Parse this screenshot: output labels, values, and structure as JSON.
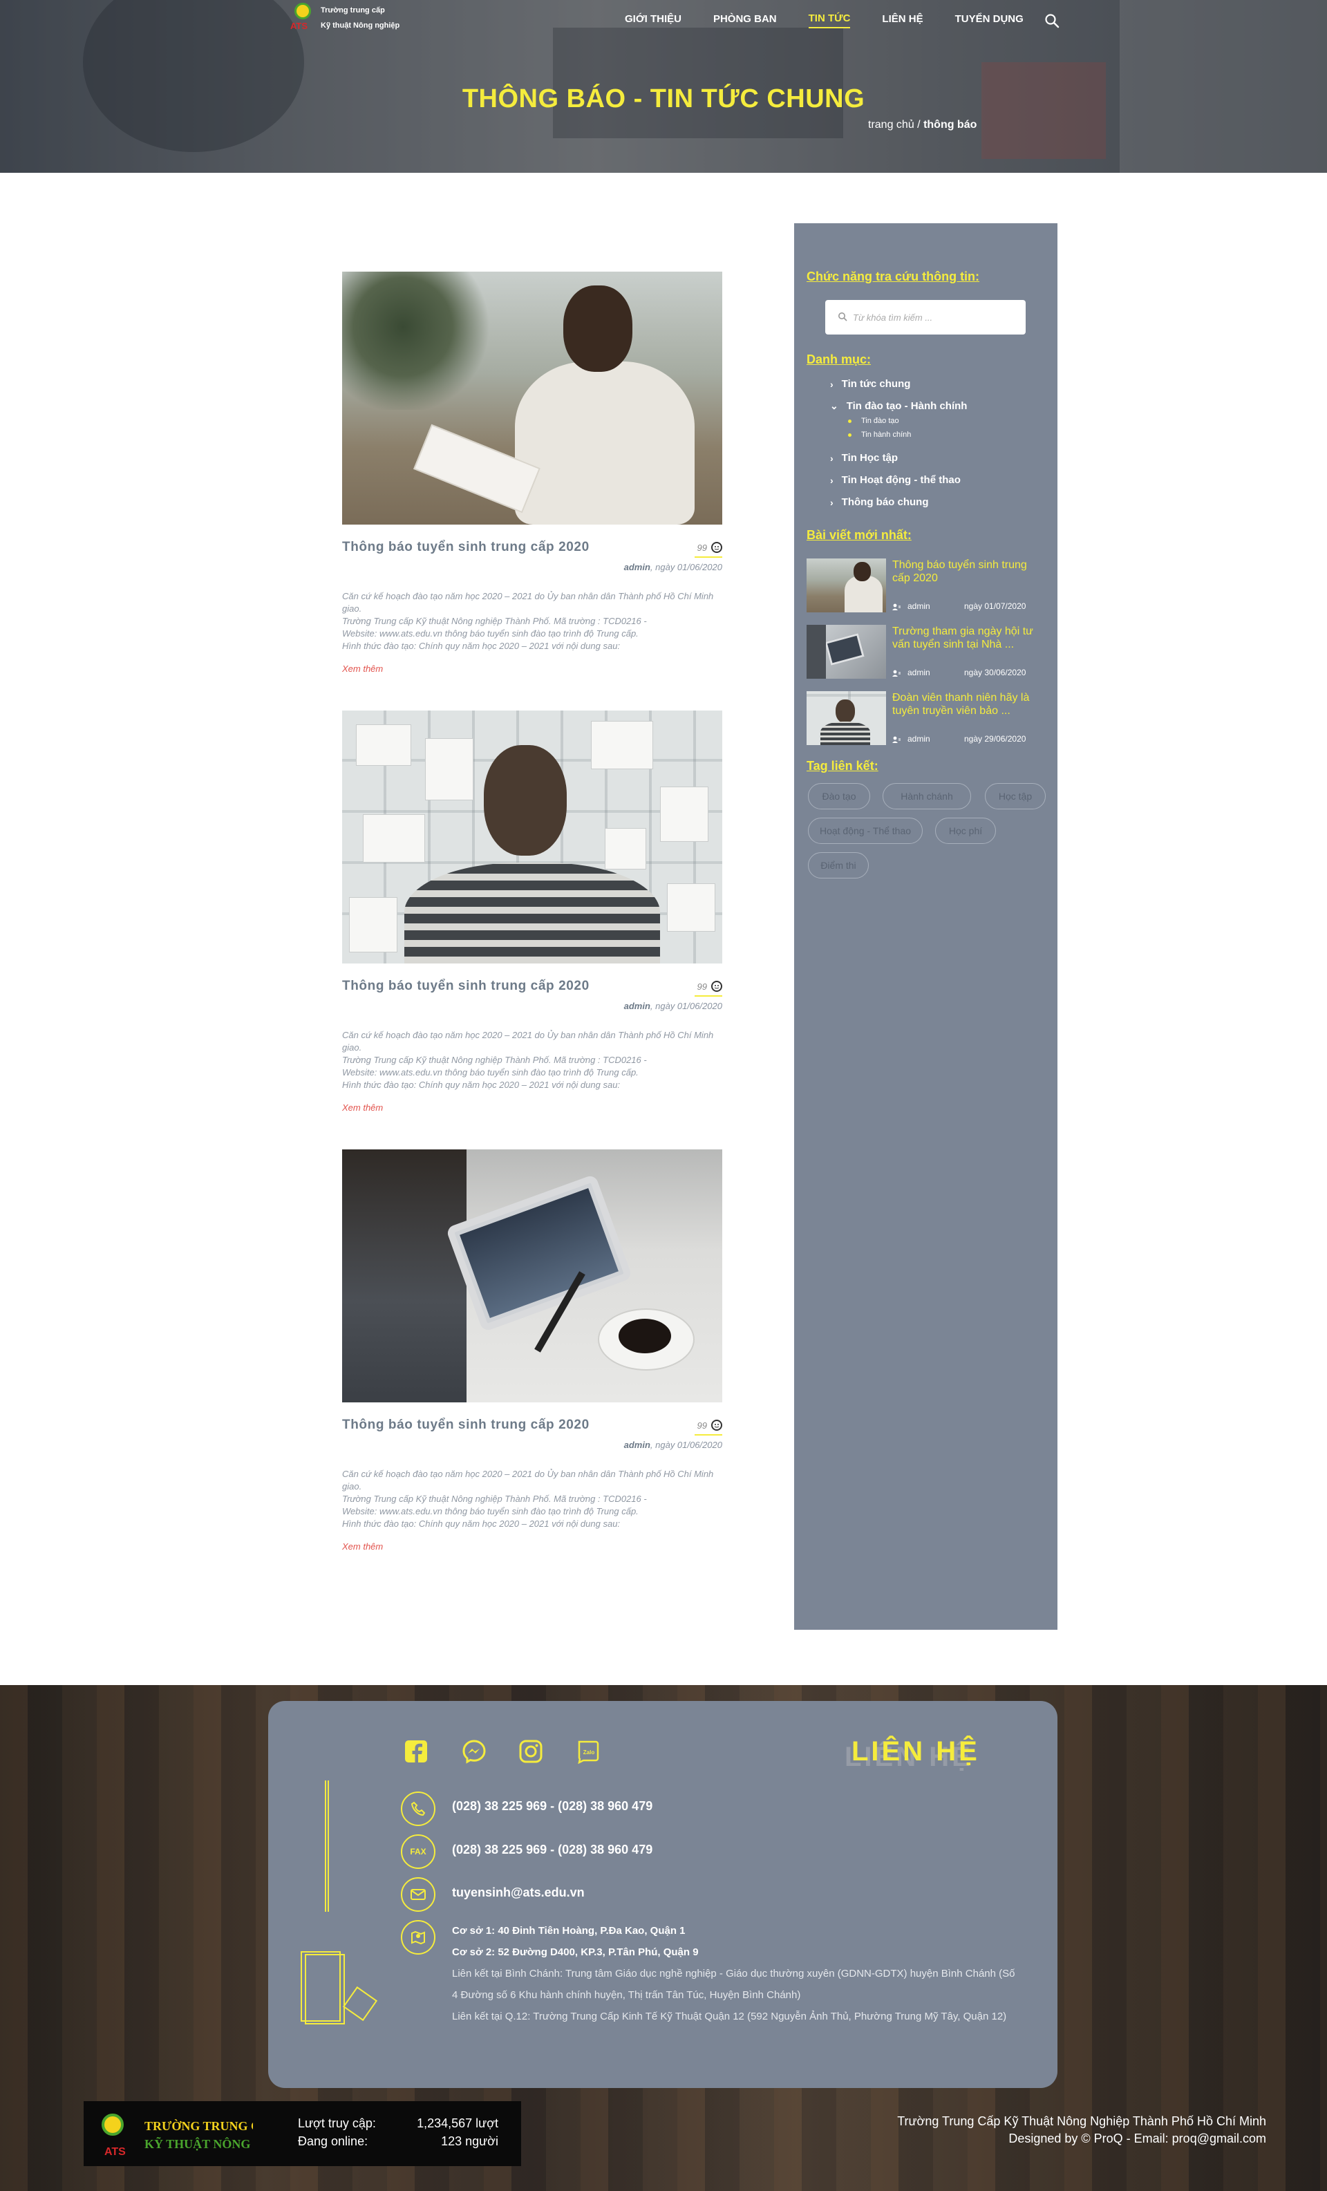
{
  "header": {
    "logo_line1": "Trường trung cấp",
    "logo_line2": "Kỹ thuật Nông nghiệp",
    "logo_badge": "ATS",
    "nav": [
      {
        "label": "GIỚI THIỆU"
      },
      {
        "label": "PHÒNG BAN"
      },
      {
        "label": "TIN TỨC"
      },
      {
        "label": "LIÊN HỆ"
      },
      {
        "label": "TUYỂN DỤNG"
      }
    ],
    "title": "THÔNG BÁO - TIN TỨC CHUNG",
    "breadcrumb_home": "trang chủ /",
    "breadcrumb_current": "thông báo"
  },
  "posts": [
    {
      "title": "Thông báo tuyển sinh trung cấp 2020",
      "comments": "99",
      "author": "admin",
      "date": ", ngày 01/06/2020",
      "excerpt1": "Căn cứ kế hoạch đào tạo năm học 2020 – 2021 do Ủy ban nhân dân Thành phố Hồ Chí Minh giao.",
      "excerpt2": "Trường Trung cấp Kỹ thuật Nông nghiệp Thành Phố. Mã trường : TCD0216 -",
      "excerpt3": "Website: www.ats.edu.vn thông báo tuyển sinh đào tạo trình độ Trung cấp.",
      "excerpt4": "Hình thức đào tạo: Chính quy năm học 2020 – 2021 với nội dung sau:",
      "read_more": "Xem thêm"
    },
    {
      "title": "Thông báo tuyển sinh trung cấp 2020",
      "comments": "99",
      "author": "admin",
      "date": ", ngày 01/06/2020",
      "excerpt1": "Căn cứ kế hoạch đào tạo năm học 2020 – 2021 do Ủy ban nhân dân Thành phố Hồ Chí Minh giao.",
      "excerpt2": "Trường Trung cấp Kỹ thuật Nông nghiệp Thành Phố. Mã trường : TCD0216 -",
      "excerpt3": "Website: www.ats.edu.vn thông báo tuyển sinh đào tạo trình độ Trung cấp.",
      "excerpt4": "Hình thức đào tạo: Chính quy năm học 2020 – 2021 với nội dung sau:",
      "read_more": "Xem thêm"
    },
    {
      "title": "Thông báo tuyển sinh trung cấp 2020",
      "comments": "99",
      "author": "admin",
      "date": ", ngày 01/06/2020",
      "excerpt1": "Căn cứ kế hoạch đào tạo năm học 2020 – 2021 do Ủy ban nhân dân Thành phố Hồ Chí Minh giao.",
      "excerpt2": "Trường Trung cấp Kỹ thuật Nông nghiệp Thành Phố. Mã trường : TCD0216 -",
      "excerpt3": "Website: www.ats.edu.vn thông báo tuyển sinh đào tạo trình độ Trung cấp.",
      "excerpt4": "Hình thức đào tạo: Chính quy năm học 2020 – 2021 với nội dung sau:",
      "read_more": "Xem thêm"
    }
  ],
  "sidebar": {
    "search_heading": "Chức năng tra cứu thông tin:",
    "search_placeholder": "Từ khóa tìm kiếm ...",
    "categories_heading": "Danh mục:",
    "categories": [
      {
        "label": "Tin tức chung"
      },
      {
        "label": "Tin đào tạo - Hành chính"
      },
      {
        "label": "Tin Học tập"
      },
      {
        "label": "Tin Hoạt động - thể thao"
      },
      {
        "label": "Thông báo chung"
      }
    ],
    "subcategories": [
      {
        "label": "Tin đào tạo"
      },
      {
        "label": "Tin hành chính"
      }
    ],
    "recent_heading": "Bài viết mới nhất:",
    "recent": [
      {
        "title": "Thông báo tuyển sinh trung cấp 2020",
        "author": "admin",
        "date": "ngày 01/07/2020"
      },
      {
        "title": "Trường tham gia ngày hội tư vấn tuyển sinh tại Nhà ...",
        "author": "admin",
        "date": "ngày 30/06/2020"
      },
      {
        "title": "Đoàn viên thanh niên hãy là tuyên truyền viên bảo ...",
        "author": "admin",
        "date": "ngày 29/06/2020"
      }
    ],
    "tags_heading": "Tag liên kết:",
    "tags": [
      {
        "label": "Đào tạo"
      },
      {
        "label": "Hành chánh"
      },
      {
        "label": "Học tập"
      },
      {
        "label": "Hoạt động - Thể thao"
      },
      {
        "label": "Học phí"
      },
      {
        "label": "Điểm thi"
      }
    ]
  },
  "footer": {
    "title": "LIÊN HỆ",
    "zalo_label": "Zalo",
    "fax_label": "FAX",
    "phone": "(028) 38 225 969  - (028) 38 960 479",
    "fax": "(028) 38 225 969  - (028) 38 960 479",
    "email": "tuyensinh@ats.edu.vn",
    "address1": "Cơ sở 1: 40 Đinh Tiên Hoàng, P.Đa Kao, Quận 1",
    "address2": "Cơ sở 2: 52 Đường D400, KP.3, P.Tân Phú, Quận 9",
    "link1": "Liên kết tại Bình Chánh: Trung tâm Giáo dục nghề nghiệp - Giáo dục thường xuyên (GDNN-GDTX) huyện Bình Chánh (Số 4  Đường số 6 Khu hành chính huyện, Thị trấn Tân Túc, Huyện Bình Chánh)",
    "link2": "Liên kết tại Q.12: Trường Trung Cấp Kinh Tế Kỹ Thuật Quận 12 (592 Nguyễn Ảnh Thủ, Phường Trung Mỹ Tây, Quận 12)",
    "stats_logo_line1": "TRƯỜNG TRUNG CẤP",
    "stats_logo_line2": "KỸ THUẬT NÔNG NGHIỆP",
    "stats_logo_badge": "ATS",
    "visits_label": "Lượt truy cập:",
    "visits_value": "1,234,567 lượt",
    "online_label": "Đang online:",
    "online_value": "123 người",
    "copyright1": "Trường Trung Cấp Kỹ Thuật Nông Nghiệp Thành Phố Hồ Chí Minh",
    "copyright2": "Designed by © ProQ - Email: proq@gmail.com"
  },
  "colors": {
    "accent": "#f5ec3d",
    "sidebar": "#7b8595",
    "link": "#e2524c"
  },
  "icons": [
    "search-icon",
    "comment-icon",
    "chevron-right-icon",
    "chevron-down-icon",
    "user-icon",
    "facebook-icon",
    "messenger-icon",
    "instagram-icon",
    "zalo-icon",
    "phone-icon",
    "fax-icon",
    "mail-icon",
    "map-icon"
  ]
}
